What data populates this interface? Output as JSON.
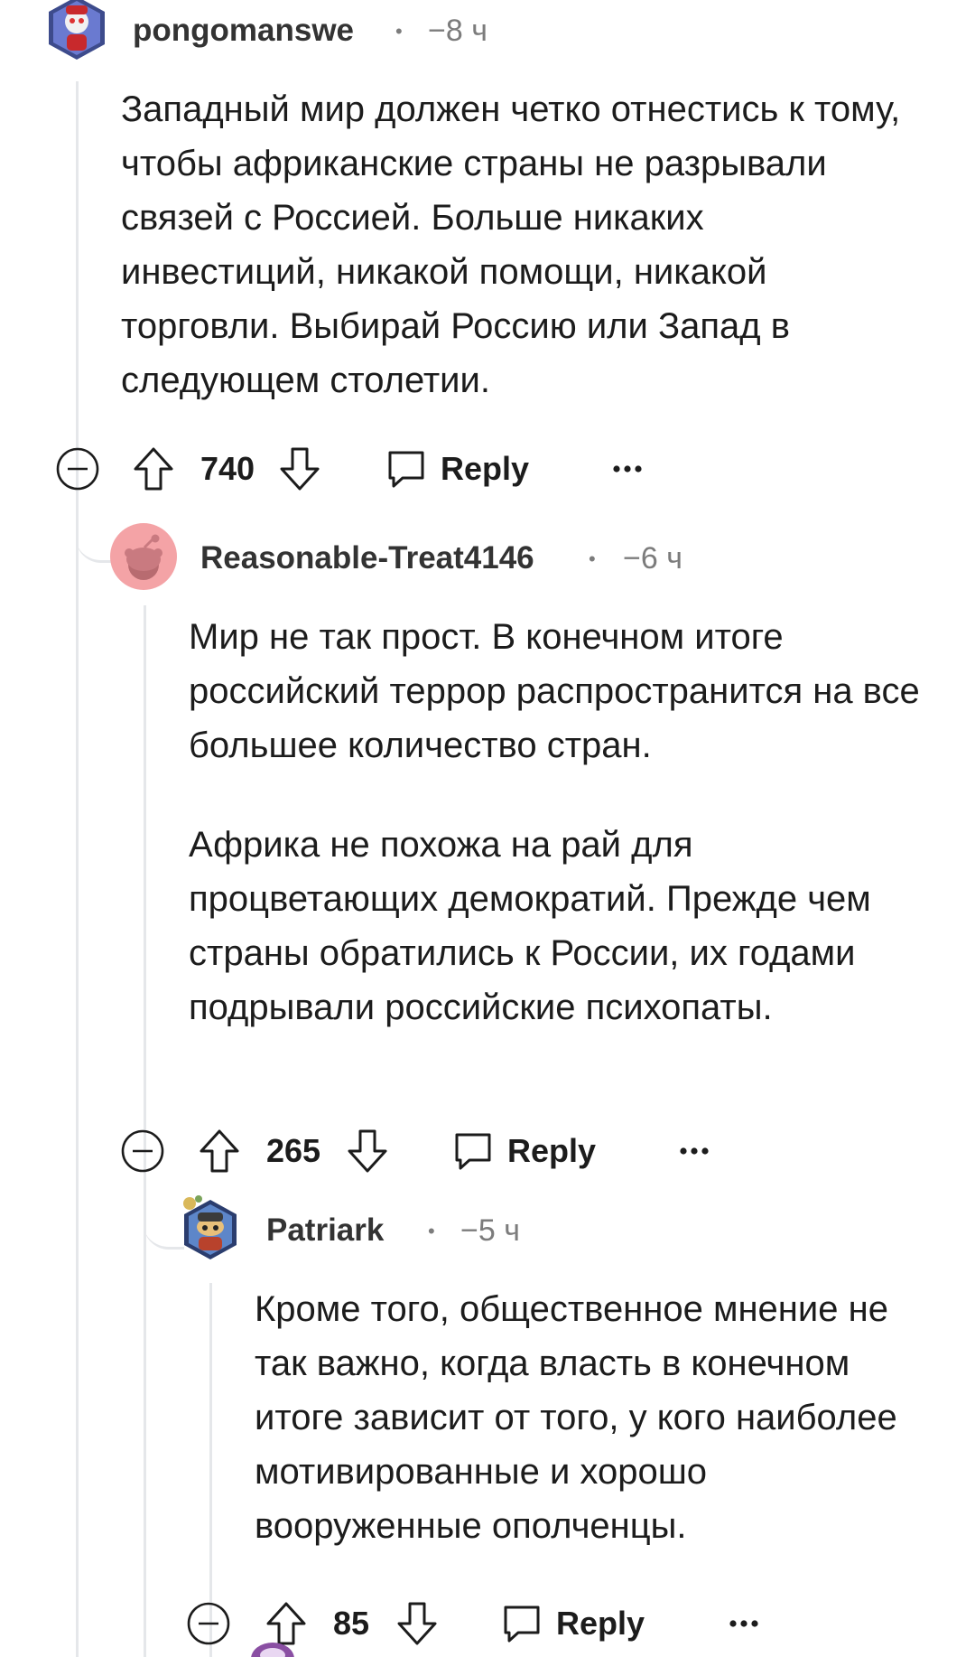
{
  "comments": [
    {
      "username": "pongomanswe",
      "time": "−8 ч",
      "paragraphs": [
        "Западный мир должен четко отнестись к тому, чтобы африканские страны не разрывали связей с Россией. Больше никаких инвестиций, никакой помощи, никакой торговли. Выбирай Россию или Запад в следующем столетии."
      ],
      "score": "740",
      "reply_label": "Reply"
    },
    {
      "username": "Reasonable-Treat4146",
      "time": "−6 ч",
      "paragraphs": [
        "Мир не так прост. В конечном итоге российский террор распространится на все большее количество стран.",
        "Африка не похожа на рай для процветающих демократий. Прежде чем страны обратились к России, их годами подрывали российские психопаты."
      ],
      "score": "265",
      "reply_label": "Reply"
    },
    {
      "username": "Patriark",
      "time": "−5 ч",
      "paragraphs": [
        "Кроме того, общественное мнение не так важно, когда власть в конечном итоге зависит от того, у кого наиболее мотивированные и хорошо вооруженные ополченцы."
      ],
      "score": "85",
      "reply_label": "Reply"
    }
  ],
  "colors": {
    "thread_line": "#e5e7ea",
    "meta_text": "#7c7c7c",
    "text": "#1c1c1c",
    "snoo_bg": "#f4a3a6"
  },
  "icons": [
    "collapse-icon",
    "upvote-icon",
    "downvote-icon",
    "comment-icon",
    "more-icon"
  ]
}
